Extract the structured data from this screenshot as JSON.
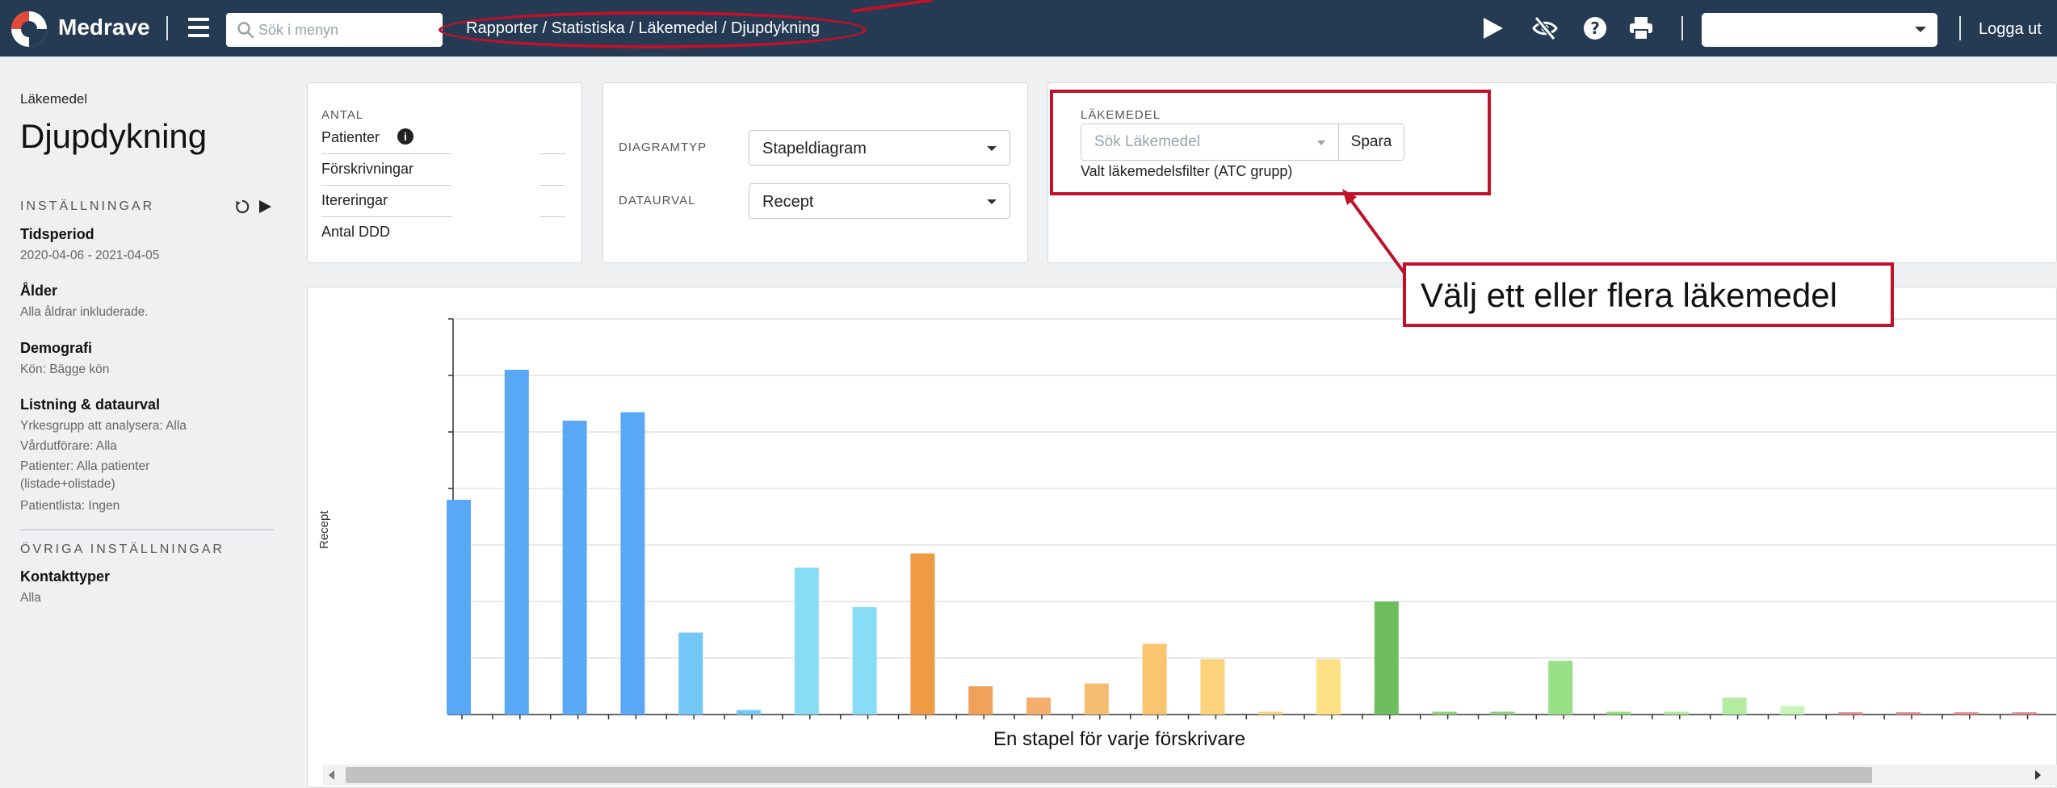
{
  "header": {
    "brand": "Medrave",
    "search_placeholder": "Sök i menyn",
    "breadcrumb": "Rapporter / Statistiska / Läkemedel / Djupdykning",
    "logout": "Logga ut",
    "user_select_value": "",
    "tools": [
      "play-icon",
      "eye-slash-icon",
      "question-icon",
      "print-icon"
    ]
  },
  "sidebar": {
    "kicker": "Läkemedel",
    "title": "Djupdykning",
    "settings_label": "INSTÄLLNINGAR",
    "period_title": "Tidsperiod",
    "period_value": "2020-04-06 - 2021-04-05",
    "age_title": "Ålder",
    "age_value": "Alla åldrar inkluderade.",
    "demo_title": "Demografi",
    "demo_value": "Kön: Bägge kön",
    "listing_title": "Listning & dataurval",
    "listing_items": [
      "Yrkesgrupp att analysera: Alla",
      "Vårdutförare: Alla",
      "Patienter: Alla patienter",
      "(listade+olistade)",
      "Patientlista: Ingen"
    ],
    "other_label": "ÖVRIGA INSTÄLLNINGAR",
    "contact_title": "Kontakttyper",
    "contact_value": "Alla"
  },
  "antal": {
    "label": "ANTAL",
    "rows": [
      "Patienter",
      "Förskrivningar",
      "Itereringar",
      "Antal DDD"
    ]
  },
  "diagram": {
    "type_label": "DIAGRAMTYP",
    "type_value": "Stapeldiagram",
    "data_label": "DATAURVAL",
    "data_value": "Recept"
  },
  "drug": {
    "label": "LÄKEMEDEL",
    "placeholder": "Sök Läkemedel",
    "save": "Spara",
    "filter_text": "Valt läkemedelsfilter (ATC grupp)"
  },
  "callout": {
    "text": "Välj ett eller flera läkemedel"
  },
  "chart_data": {
    "type": "bar",
    "xlabel": "En stapel för varje förskrivare",
    "ylabel": "Recept",
    "grid": true,
    "values": [
      3.8,
      6.1,
      5.2,
      5.35,
      1.45,
      0.08,
      2.6,
      1.9,
      2.85,
      0.5,
      0.3,
      0.55,
      1.25,
      0.98,
      0.05,
      0.98,
      2.0,
      0.05,
      0.05,
      0.95,
      0.05,
      0.05,
      0.3,
      0.15,
      0.04,
      0.04,
      0.04,
      0.04
    ],
    "colors": [
      "#59a8f5",
      "#59a8f5",
      "#59a8f5",
      "#59a8f5",
      "#74c8f7",
      "#74c8f7",
      "#88dcf5",
      "#88dcf5",
      "#ef9a44",
      "#f0a15a",
      "#f3ae6b",
      "#f6bd72",
      "#fbc46e",
      "#fdd27d",
      "#fdd27d",
      "#fde083",
      "#6fbe5d",
      "#8fd17e",
      "#8fd17e",
      "#98e085",
      "#98e085",
      "#b3eca0",
      "#b3eca0",
      "#c6f3b7",
      "#e88a8a",
      "#e88a8a",
      "#e88a8a",
      "#e88a8a"
    ],
    "ylim": [
      0,
      7
    ]
  }
}
